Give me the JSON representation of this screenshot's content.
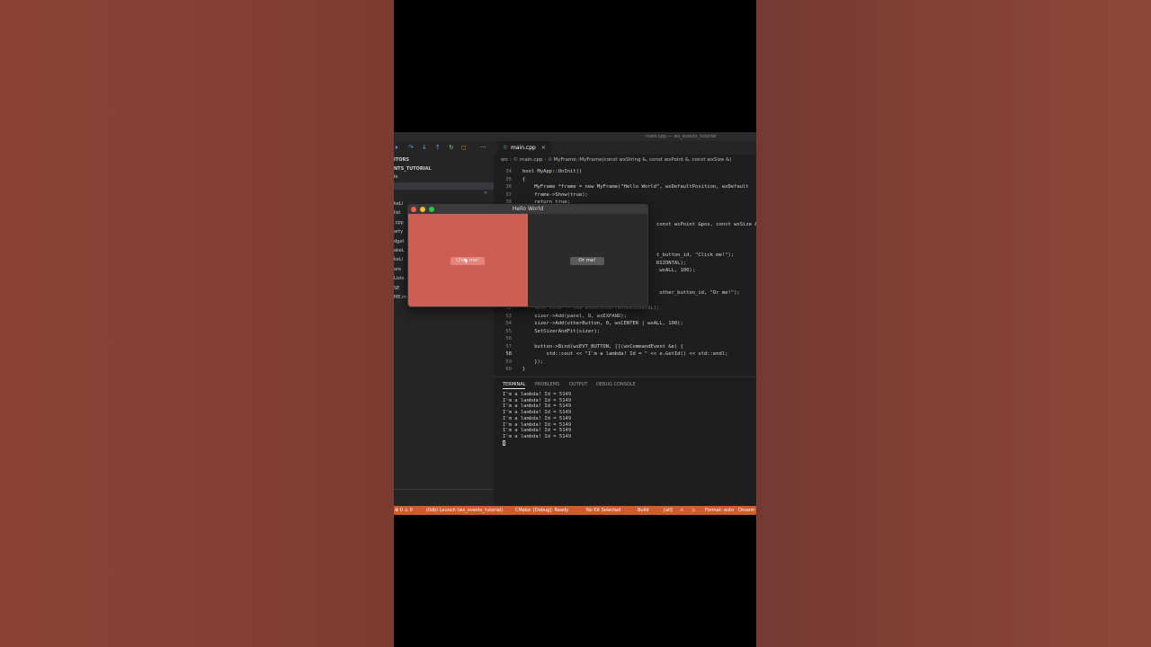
{
  "colors": {
    "accent_status": "#d15b2b",
    "panel_red": "#cc5e53",
    "editor_bg": "#1e1e1e"
  },
  "titlebar": {
    "text": "main.cpp — wx_events_tutorial"
  },
  "debug_toolbar": {
    "icons": [
      "pause-icon",
      "step-over-icon",
      "step-into-icon",
      "step-out-icon",
      "restart-icon",
      "stop-icon"
    ],
    "more": "···"
  },
  "sidebar": {
    "section": "ITORS",
    "project": "NTS_TUTORIAL",
    "items": [
      "le",
      "keLi",
      "list",
      ".cpp",
      "arty",
      "dget",
      "akeL",
      "keLi",
      "ore",
      "Lists",
      "SE",
      "ME.m"
    ]
  },
  "tabs": [
    {
      "label": "main.cpp",
      "close": "×"
    }
  ],
  "breadcrumb": {
    "src": "src",
    "file": "main.cpp",
    "symbol": "MyFrame::MyFrame(const wxString &, const wxPoint &, const wxSize &)"
  },
  "code": {
    "lines": [
      {
        "n": "34",
        "t": "bool MyApp::OnInit()"
      },
      {
        "n": "35",
        "t": "{"
      },
      {
        "n": "36",
        "t": "    MyFrame *frame = new MyFrame(\"Hello World\", wxDefaultPosition, wxDefault"
      },
      {
        "n": "37",
        "t": "    frame->Show(true);"
      },
      {
        "n": "38",
        "t": "    return true;"
      },
      {
        "n": "",
        "t": "                                             const wxPoint &pos, const wxSize &si"
      },
      {
        "n": "",
        "t": "                                             t_button_id, \"Click me!\");"
      },
      {
        "n": "",
        "t": "                                             RIZONTAL);"
      },
      {
        "n": "",
        "t": "                                              wxALL, 100);"
      },
      {
        "n": "",
        "t": "                                              other_button_id, \"Or me!\");"
      },
      {
        "n": "52",
        "t": "    auto sizer = new wxBoxSizer(wxHORIZONTAL);"
      },
      {
        "n": "53",
        "t": "    sizer->Add(panel, 0, wxEXPAND);"
      },
      {
        "n": "54",
        "t": "    sizer->Add(otherButton, 0, wxCENTER | wxALL, 100);"
      },
      {
        "n": "55",
        "t": "    SetSizerAndFit(sizer);"
      },
      {
        "n": "56",
        "t": ""
      },
      {
        "n": "57",
        "t": "    button->Bind(wxEVT_BUTTON, [](wxCommandEvent &e) {"
      },
      {
        "n": "58",
        "t": "        std::cout << \"I'm a lambda! Id = \" << e.GetId() << std::endl;"
      },
      {
        "n": "59",
        "t": "    });"
      },
      {
        "n": "60",
        "t": "}"
      }
    ]
  },
  "panel": {
    "tabs": [
      "TERMINAL",
      "PROBLEMS",
      "OUTPUT",
      "DEBUG CONSOLE"
    ],
    "terminal_output": "I'm a lambda! Id = 5149\nI'm a lambda! Id = 5149\nI'm a lambda! Id = 5149\nI'm a lambda! Id = 5149\nI'm a lambda! Id = 5149\nI'm a lambda! Id = 5149\nI'm a lambda! Id = 5149\nI'm a lambda! Id = 5149"
  },
  "statusbar": {
    "problems": "⊗ 0 ⚠ 0",
    "launch": "(lldb) Launch (wx_events_tutorial)",
    "cmake": "CMake: [Debug]: Ready",
    "kit": "No Kit Selected",
    "build": "Build",
    "target": "[all]",
    "format": "Format: auto",
    "disasm": "Disasm"
  },
  "app_window": {
    "title": "Hello World",
    "click_button": "Click me!",
    "or_button": "Or me!"
  }
}
